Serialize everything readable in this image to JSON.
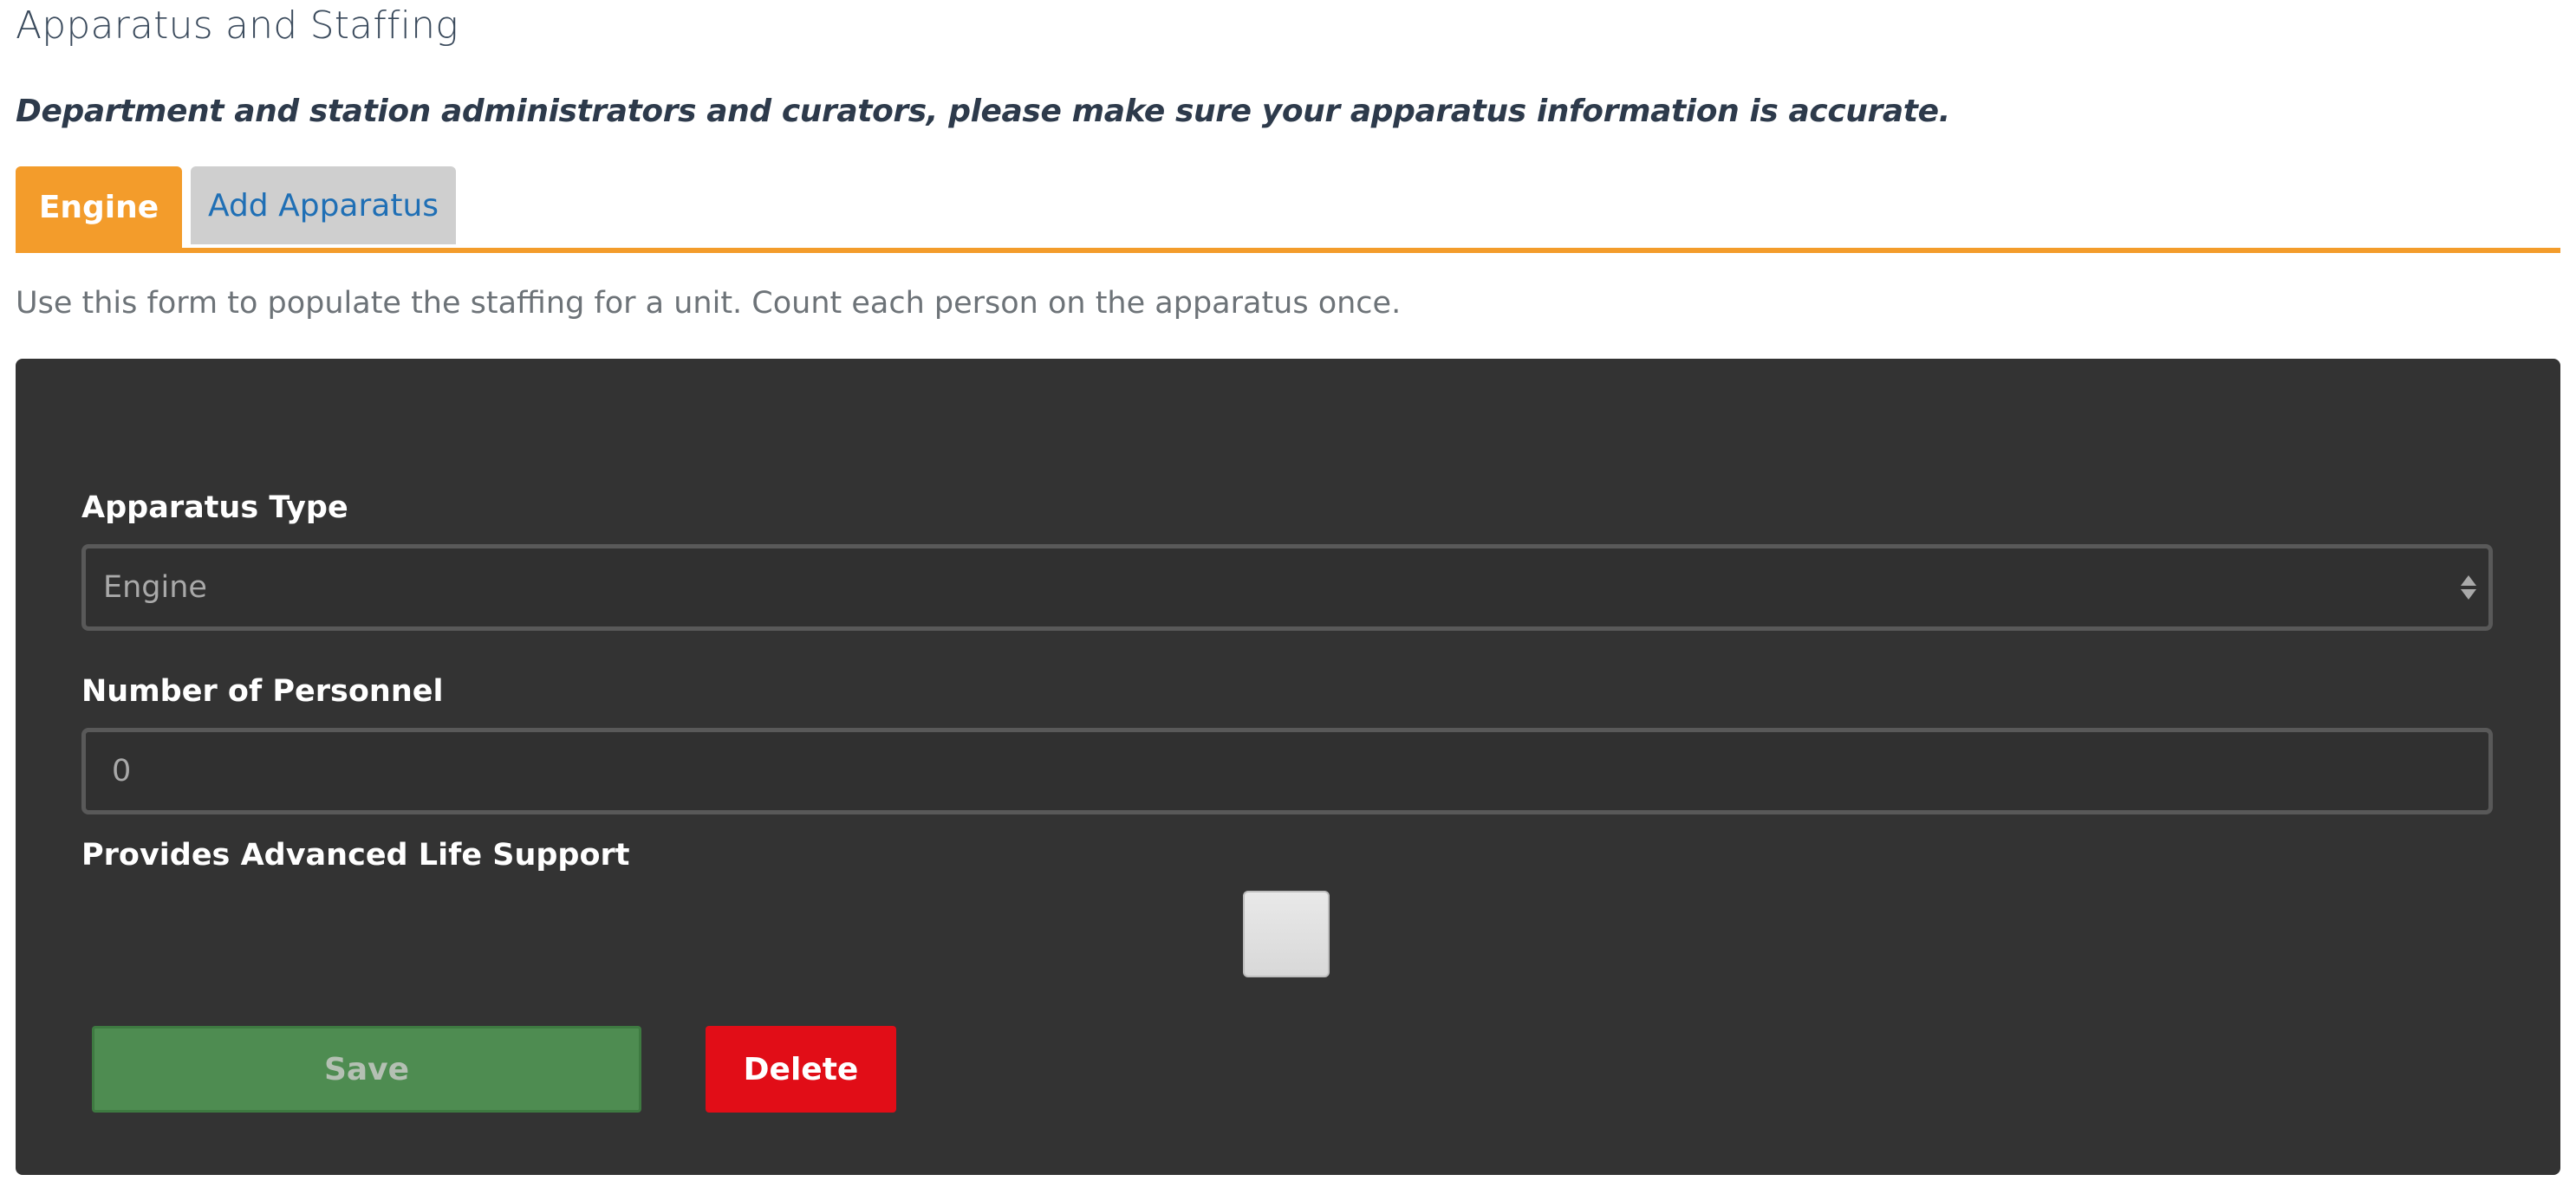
{
  "header": {
    "title": "Apparatus and Staffing",
    "notice": "Department and station administrators and curators, please make sure your apparatus information is accurate."
  },
  "tabs": [
    {
      "label": "Engine",
      "active": true
    },
    {
      "label": "Add Apparatus",
      "active": false
    }
  ],
  "form": {
    "help_text": "Use this form to populate the staffing for a unit. Count each person on the apparatus once.",
    "apparatus_type": {
      "label": "Apparatus Type",
      "value": "Engine"
    },
    "personnel": {
      "label": "Number of Personnel",
      "value": "0"
    },
    "als": {
      "label": "Provides Advanced Life Support",
      "checked": false
    },
    "save_label": "Save",
    "delete_label": "Delete"
  },
  "colors": {
    "accent_orange": "#f39c2b",
    "panel_bg": "#333333",
    "save_green": "#4e8c51",
    "delete_red": "#e10d17",
    "tab_link_blue": "#1f6fb5"
  },
  "icons": {
    "select_arrows": "up-down-chevron-icon"
  }
}
